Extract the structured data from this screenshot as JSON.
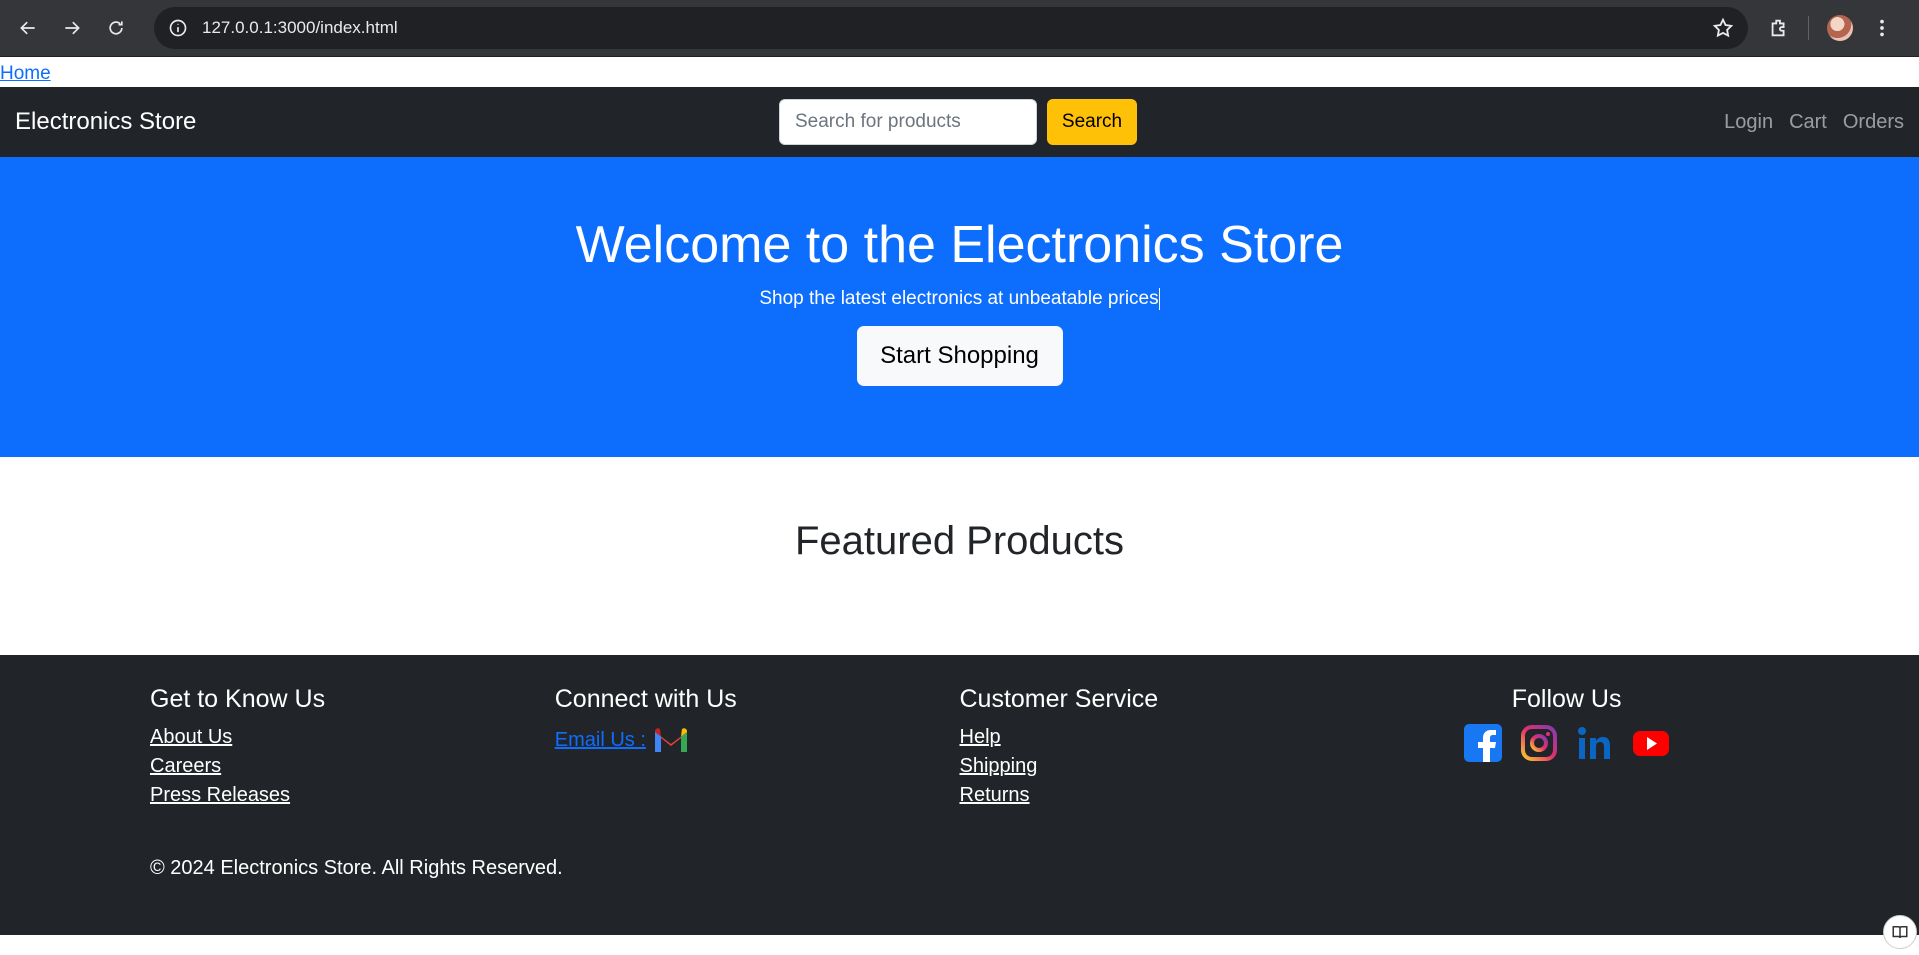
{
  "browser": {
    "url": "127.0.0.1:3000/index.html"
  },
  "page": {
    "home_link": "Home",
    "navbar": {
      "brand": "Electronics Store",
      "search_placeholder": "Search for products",
      "search_button": "Search",
      "links": [
        "Login",
        "Cart",
        "Orders"
      ]
    },
    "hero": {
      "title": "Welcome to the Electronics Store",
      "subtitle": "Shop the latest electronics at unbeatable prices",
      "cta": "Start Shopping"
    },
    "featured": {
      "title": "Featured Products"
    },
    "footer": {
      "col1": {
        "title": "Get to Know Us",
        "links": [
          "About Us",
          "Careers",
          "Press Releases"
        ]
      },
      "col2": {
        "title": "Connect with Us",
        "email_label": "Email Us :"
      },
      "col3": {
        "title": "Customer Service",
        "links": [
          "Help",
          "Shipping",
          "Returns"
        ]
      },
      "col4": {
        "title": "Follow Us",
        "icons": [
          "facebook-icon",
          "instagram-icon",
          "linkedin-icon",
          "youtube-icon"
        ]
      },
      "copyright": "© 2024 Electronics Store. All Rights Reserved."
    }
  },
  "colors": {
    "primary": "#0d6efd",
    "dark": "#212529",
    "warning": "#ffc107"
  }
}
